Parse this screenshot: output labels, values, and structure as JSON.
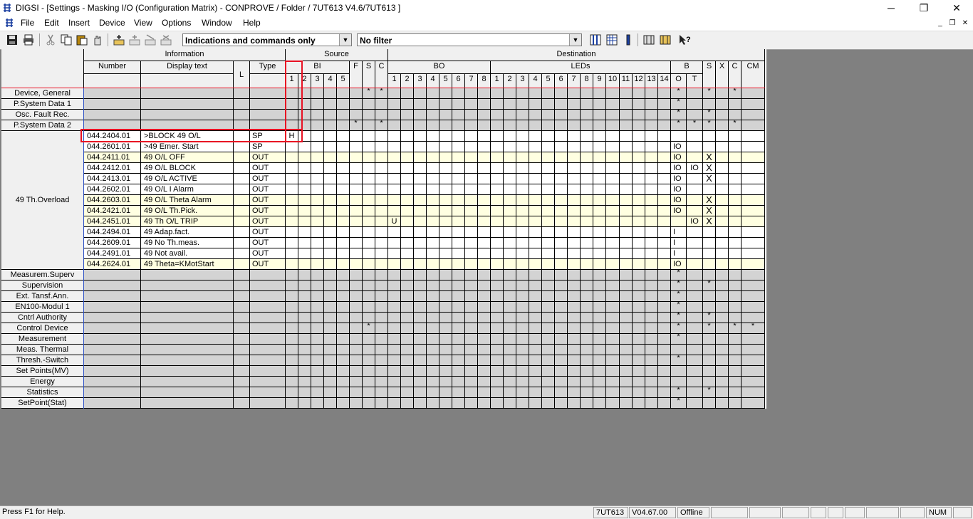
{
  "window": {
    "title": "DIGSI - [Settings - Masking I/O (Configuration Matrix) - CONPROVE / Folder / 7UT613 V4.6/7UT613 ]",
    "minimize": "─",
    "maximize": "❐",
    "close": "✕"
  },
  "menu": [
    "File",
    "Edit",
    "Insert",
    "Device",
    "View",
    "Options",
    "Window",
    "Help"
  ],
  "mdi": {
    "minimize": "_",
    "restore": "❐",
    "close": "✕"
  },
  "toolbar": {
    "view_combo": "Indications and commands only",
    "filter_combo": "No filter"
  },
  "matrix": {
    "header": {
      "information": "Information",
      "number": "Number",
      "display_text": "Display text",
      "l": "L",
      "type": "Type",
      "source": "Source",
      "destination": "Destination",
      "bi": "BI",
      "f": "F",
      "s": "S",
      "c": "C",
      "bo": "BO",
      "leds": "LEDs",
      "b": "B",
      "s2": "S",
      "x": "X",
      "c2": "C",
      "cm": "CM",
      "bi_nums": [
        "1",
        "2",
        "3",
        "4",
        "5"
      ],
      "bo_nums": [
        "1",
        "2",
        "3",
        "4",
        "5",
        "6",
        "7",
        "8"
      ],
      "led_nums": [
        "1",
        "2",
        "3",
        "4",
        "5",
        "6",
        "7",
        "8",
        "9",
        "10",
        "11",
        "12",
        "13",
        "14"
      ],
      "b_sub": [
        "O",
        "T"
      ]
    },
    "groups_top": [
      "Device, General",
      "P.System Data 1",
      "Osc. Fault Rec.",
      "P.System Data 2"
    ],
    "expanded_group": "49 Th.Overload",
    "rows": [
      {
        "number": "044.2404.01",
        "text": ">BLOCK 49 O/L",
        "type": "SP",
        "bi1": "H",
        "bo1": "",
        "bo": "",
        "bt": "",
        "s": "",
        "style": "sel"
      },
      {
        "number": "044.2601.01",
        "text": ">49 Emer. Start",
        "type": "SP",
        "bi1": "",
        "bo1": "",
        "bo": "IO",
        "bt": "",
        "s": "",
        "style": "w"
      },
      {
        "number": "044.2411.01",
        "text": "49 O/L OFF",
        "type": "OUT",
        "bi1": "",
        "bo1": "",
        "bo": "IO",
        "bt": "",
        "s": "X",
        "style": "y"
      },
      {
        "number": "044.2412.01",
        "text": "49 O/L BLOCK",
        "type": "OUT",
        "bi1": "",
        "bo1": "",
        "bo": "IO",
        "bt": "IO",
        "s": "X",
        "style": "w"
      },
      {
        "number": "044.2413.01",
        "text": "49 O/L ACTIVE",
        "type": "OUT",
        "bi1": "",
        "bo1": "",
        "bo": "IO",
        "bt": "",
        "s": "X",
        "style": "w"
      },
      {
        "number": "044.2602.01",
        "text": "49 O/L I Alarm",
        "type": "OUT",
        "bi1": "",
        "bo1": "",
        "bo": "IO",
        "bt": "",
        "s": "",
        "style": "w"
      },
      {
        "number": "044.2603.01",
        "text": "49 O/L Theta Alarm",
        "type": "OUT",
        "bi1": "",
        "bo1": "",
        "bo": "IO",
        "bt": "",
        "s": "X",
        "style": "y"
      },
      {
        "number": "044.2421.01",
        "text": "49 O/L Th.Pick.",
        "type": "OUT",
        "bi1": "",
        "bo1": "",
        "bo": "IO",
        "bt": "",
        "s": "X",
        "style": "y"
      },
      {
        "number": "044.2451.01",
        "text": "49 Th O/L TRIP",
        "type": "OUT",
        "bi1": "",
        "bo1": "U",
        "bo": "",
        "bt": "IO",
        "s": "X",
        "style": "y"
      },
      {
        "number": "044.2494.01",
        "text": "49 Adap.fact.",
        "type": "OUT",
        "bi1": "",
        "bo1": "",
        "bo": "I",
        "bt": "",
        "s": "",
        "style": "w"
      },
      {
        "number": "044.2609.01",
        "text": "49 No Th.meas.",
        "type": "OUT",
        "bi1": "",
        "bo1": "",
        "bo": "I",
        "bt": "",
        "s": "",
        "style": "w"
      },
      {
        "number": "044.2491.01",
        "text": "49 Not avail.",
        "type": "OUT",
        "bi1": "",
        "bo1": "",
        "bo": "I",
        "bt": "",
        "s": "",
        "style": "w"
      },
      {
        "number": "044.2624.01",
        "text": "49 Theta=KMotStart",
        "type": "OUT",
        "bi1": "",
        "bo1": "",
        "bo": "IO",
        "bt": "",
        "s": "",
        "style": "y"
      }
    ],
    "groups_bottom": [
      "Measurem.Superv",
      "Supervision",
      "Ext. Tansf.Ann.",
      "EN100-Modul 1",
      "Cntrl Authority",
      "Control Device",
      "Measurement",
      "Meas. Thermal",
      "Thresh.-Switch",
      "Set Points(MV)",
      "Energy",
      "Statistics",
      "SetPoint(Stat)"
    ],
    "group_marks": {
      "Device, General": {
        "s": "*",
        "c": "*",
        "bo": "*",
        "s2": "*",
        "c2": "*"
      },
      "P.System Data 1": {
        "bo": "*"
      },
      "Osc. Fault Rec.": {
        "bo": "*",
        "s2": "*"
      },
      "P.System Data 2": {
        "f": "*",
        "c": "*",
        "bo": "*",
        "bt": "*",
        "s2": "*",
        "c2": "*"
      },
      "Measurem.Superv": {
        "bo": "*"
      },
      "Supervision": {
        "bo": "*",
        "s2": "*"
      },
      "Ext. Tansf.Ann.": {
        "bo": "*"
      },
      "EN100-Modul 1": {
        "bo": "*"
      },
      "Cntrl Authority": {
        "bo": "*",
        "s2": "*"
      },
      "Control Device": {
        "s": "*",
        "bo": "*",
        "s2": "*",
        "c2": "*",
        "cm": "*"
      },
      "Measurement": {
        "bo": "*"
      },
      "Meas. Thermal": {},
      "Thresh.-Switch": {
        "bo": "*"
      },
      "Set Points(MV)": {},
      "Energy": {},
      "Statistics": {
        "bo": "*",
        "s2": "*"
      },
      "SetPoint(Stat)": {
        "bo": "*"
      }
    }
  },
  "status": {
    "help": "Press F1 for Help.",
    "device": "7UT613",
    "version": "V04.67.00",
    "mode": "Offline",
    "num": "NUM"
  }
}
